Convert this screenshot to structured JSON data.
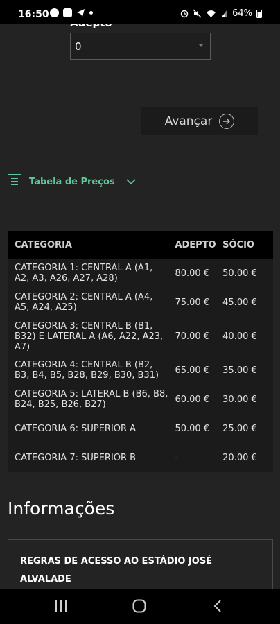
{
  "status_bar": {
    "time": "16:50",
    "battery": "64%",
    "left_icons": [
      "whatsapp-icon",
      "youtube-icon",
      "telegram-icon",
      "dot-icon"
    ],
    "right_icons": [
      "alarm-icon",
      "mute-icon",
      "wifi-icon",
      "signal-icon",
      "battery-icon"
    ]
  },
  "ticket_form": {
    "adepto_label": "Adepto",
    "adepto_selected": "0"
  },
  "next_button": {
    "label": "Avançar"
  },
  "price_table": {
    "toggle_label": "Tabela de Preços",
    "headers": {
      "categoria": "CATEGORIA",
      "adepto": "ADEPTO",
      "socio": "SÓCIO"
    },
    "rows": [
      {
        "categoria": "CATEGORIA 1: CENTRAL A (A1, A2, A3, A26, A27, A28)",
        "adepto": "80.00 €",
        "socio": "50.00 €"
      },
      {
        "categoria": "CATEGORIA 2: CENTRAL A (A4, A5, A24, A25)",
        "adepto": "75.00 €",
        "socio": "45.00 €"
      },
      {
        "categoria": "CATEGORIA 3: CENTRAL B (B1, B32) E LATERAL A (A6, A22, A23, A7)",
        "adepto": "70.00 €",
        "socio": "40.00 €"
      },
      {
        "categoria": "CATEGORIA 4: CENTRAL B (B2, B3, B4, B5, B28, B29, B30, B31)",
        "adepto": "65.00 €",
        "socio": "35.00 €"
      },
      {
        "categoria": "CATEGORIA 5: LATERAL B (B6, B8, B24, B25, B26, B27)",
        "adepto": "60.00 €",
        "socio": "30.00 €"
      },
      {
        "categoria": "CATEGORIA 6: SUPERIOR A",
        "adepto": "50.00 €",
        "socio": "25.00 €"
      },
      {
        "categoria": "CATEGORIA 7: SUPERIOR B",
        "adepto": "-",
        "socio": "20.00 €"
      }
    ]
  },
  "info": {
    "title": "Informações",
    "rules_title": "REGRAS DE ACESSO AO ESTÁDIO JOSÉ ALVALADE"
  },
  "colors": {
    "accent": "#5ec79a",
    "background": "#232323",
    "table_header": "#000000"
  }
}
